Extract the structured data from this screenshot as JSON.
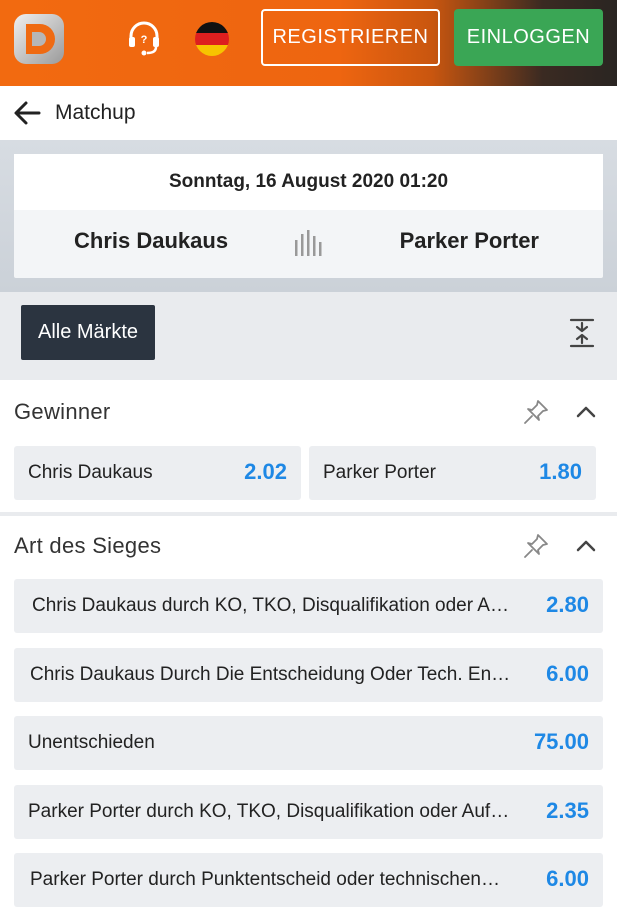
{
  "header": {
    "register_label": "REGISTRIEREN",
    "login_label": "EINLOGGEN",
    "language": "de",
    "brand_color": "#f26a10",
    "login_color": "#3aa655"
  },
  "nav": {
    "back_label": "Matchup"
  },
  "event": {
    "datetime": "Sonntag, 16 August 2020 01:20",
    "home": "Chris Daukaus",
    "away": "Parker Porter"
  },
  "filter": {
    "label": "Alle Märkte"
  },
  "markets": [
    {
      "title": "Gewinner",
      "outcomes": [
        {
          "label": "Chris Daukaus",
          "odds": "2.02"
        },
        {
          "label": "Parker Porter",
          "odds": "1.80"
        }
      ]
    },
    {
      "title": "Art des Sieges",
      "outcomes": [
        {
          "label": "Chris Daukaus durch KO, TKO, Disqualifikation oder A…",
          "odds": "2.80"
        },
        {
          "label": "Chris Daukaus Durch Die Entscheidung Oder Tech. En…",
          "odds": "6.00"
        },
        {
          "label": "Unentschieden",
          "odds": "75.00"
        },
        {
          "label": "Parker Porter durch KO, TKO, Disqualifikation oder Auf…",
          "odds": "2.35"
        },
        {
          "label": "Parker Porter durch Punktentscheid oder technischen…",
          "odds": "6.00"
        }
      ]
    }
  ],
  "colors": {
    "odds": "#1e88e5",
    "filter_bg": "#2b3440"
  }
}
